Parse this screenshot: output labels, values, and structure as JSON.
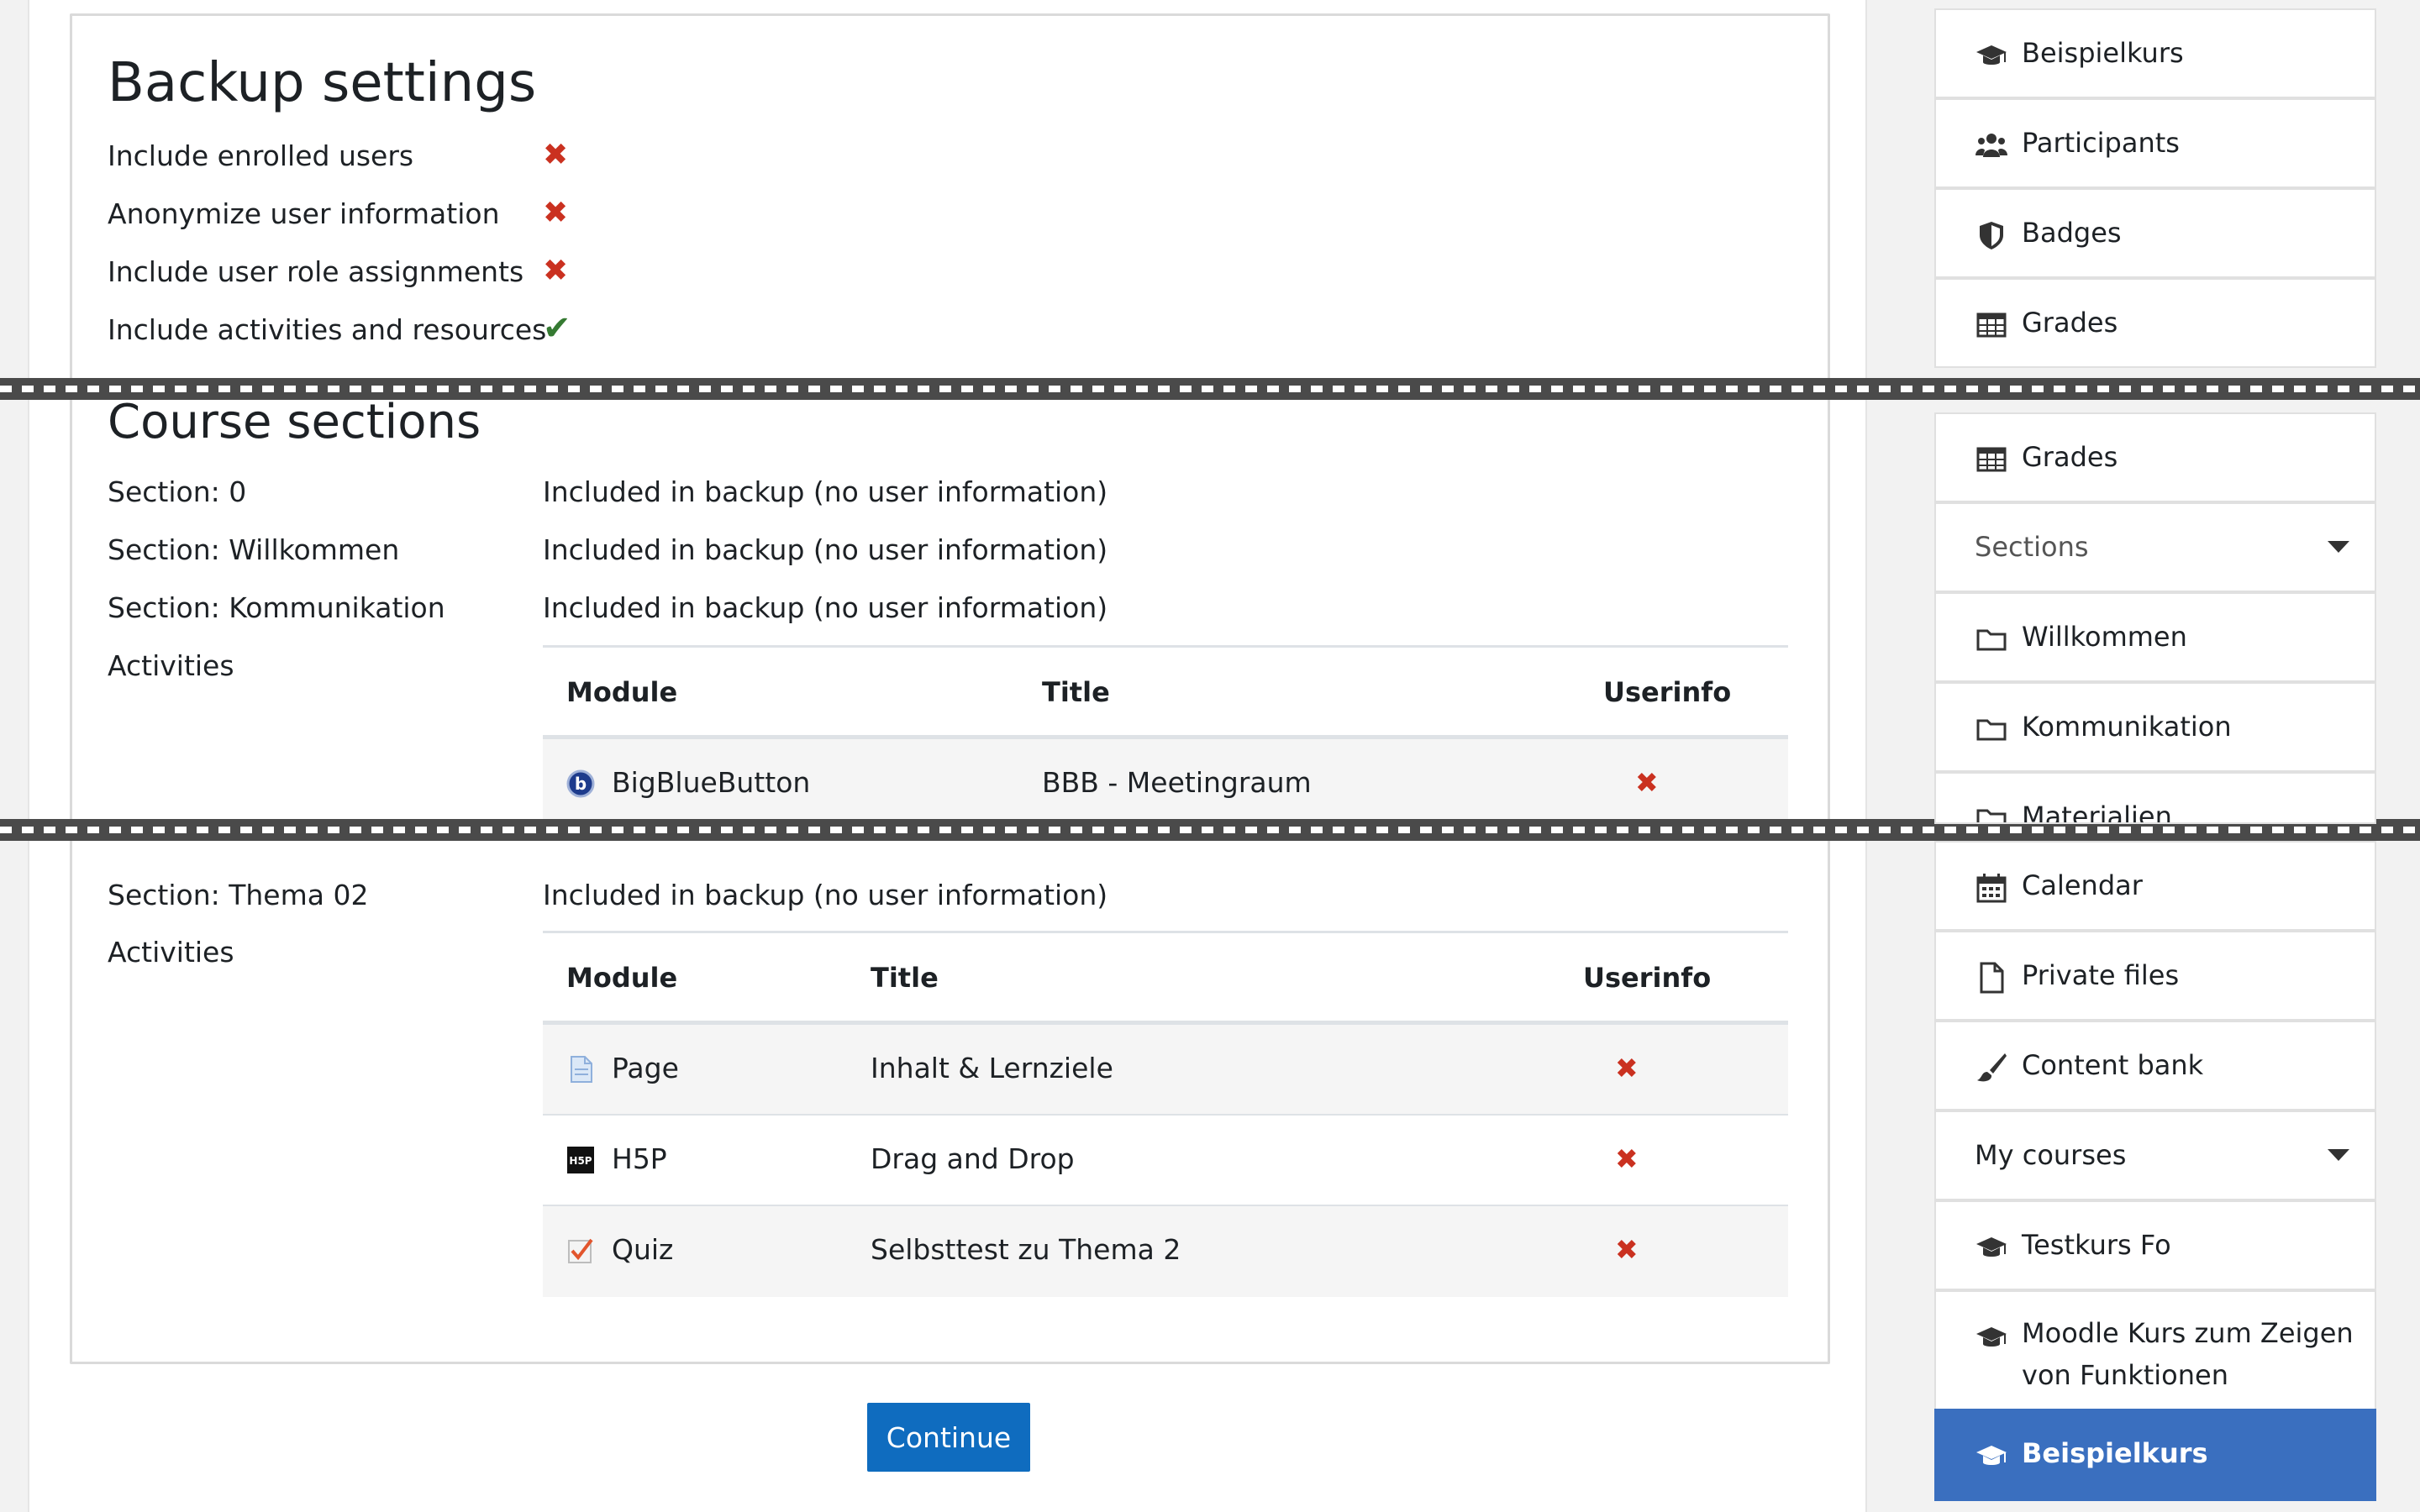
{
  "backup_settings": {
    "title": "Backup settings",
    "settings": [
      {
        "label": "Include enrolled users",
        "status": "excluded"
      },
      {
        "label": "Anonymize user information",
        "status": "excluded"
      },
      {
        "label": "Include user role assignments",
        "status": "excluded"
      },
      {
        "label": "Include activities and resources",
        "status": "included"
      }
    ],
    "icons": {
      "excluded": "✖",
      "included": "✔"
    }
  },
  "course_sections": {
    "title": "Course sections",
    "sections": [
      {
        "label": "Section: 0",
        "value": "Included in backup (no user information)"
      },
      {
        "label": "Section: Willkommen",
        "value": "Included in backup (no user information)"
      },
      {
        "label": "Section: Kommunikation",
        "value": "Included in backup (no user information)"
      }
    ],
    "activities_label": "Activities",
    "table1": {
      "headers": {
        "module": "Module",
        "title": "Title",
        "userinfo": "Userinfo"
      },
      "rows": [
        {
          "module": "BigBlueButton",
          "title": "BBB - Meetingraum",
          "userinfo": "✖",
          "icon": "bigbluebutton-icon"
        }
      ]
    },
    "section_thema": {
      "label": "Section: Thema 02",
      "value": "Included in backup (no user information)"
    },
    "activities_label2": "Activities",
    "table2": {
      "headers": {
        "module": "Module",
        "title": "Title",
        "userinfo": "Userinfo"
      },
      "rows": [
        {
          "module": "Page",
          "title": "Inhalt & Lernziele",
          "userinfo": "✖",
          "icon": "page-icon"
        },
        {
          "module": "H5P",
          "title": "Drag and Drop",
          "userinfo": "✖",
          "icon": "h5p-icon"
        },
        {
          "module": "Quiz",
          "title": "Selbsttest zu Thema 2",
          "userinfo": "✖",
          "icon": "quiz-icon"
        }
      ]
    }
  },
  "continue_label": "Continue",
  "colors": {
    "primary": "#0f6cbf",
    "active_nav": "#3a6fbf",
    "error": "#ca3120",
    "success": "#357a32"
  },
  "sidebar": {
    "items": [
      {
        "label": "Beispielkurs",
        "icon": "graduation-cap-icon"
      },
      {
        "label": "Participants",
        "icon": "users-icon"
      },
      {
        "label": "Badges",
        "icon": "shield-icon"
      },
      {
        "label": "Grades",
        "icon": "table-icon"
      },
      {
        "label": "Grades",
        "icon": "table-icon"
      },
      {
        "label": "Sections",
        "icon": "caret-down-icon"
      },
      {
        "label": "Willkommen",
        "icon": "folder-icon"
      },
      {
        "label": "Kommunikation",
        "icon": "folder-icon"
      },
      {
        "label": "Materialien",
        "icon": "folder-icon"
      },
      {
        "label": "Calendar",
        "icon": "calendar-icon"
      },
      {
        "label": "Private files",
        "icon": "file-icon"
      },
      {
        "label": "Content bank",
        "icon": "paintbrush-icon"
      },
      {
        "label": "My courses",
        "icon": "caret-down-icon"
      },
      {
        "label": "Testkurs Fo",
        "icon": "graduation-cap-icon"
      },
      {
        "label": "Moodle Kurs zum Zeigen von Funktionen",
        "icon": "graduation-cap-icon"
      },
      {
        "label": "Beispielkurs",
        "icon": "graduation-cap-icon"
      }
    ]
  }
}
